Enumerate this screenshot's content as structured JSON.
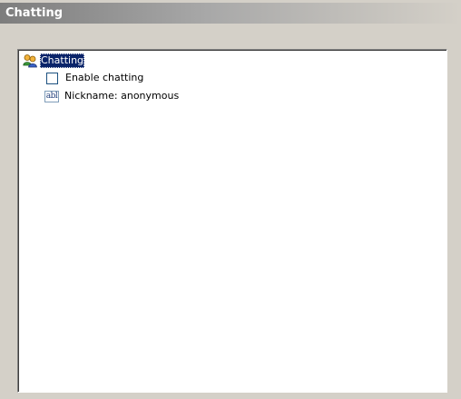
{
  "header": {
    "title": "Chatting"
  },
  "tree": {
    "root": {
      "label": "Chatting",
      "icon": "users-icon",
      "selected": true
    },
    "items": [
      {
        "type": "checkbox",
        "label": "Enable chatting",
        "checked": false
      },
      {
        "type": "text-field",
        "label": "Nickname: anonymous",
        "icon": "text-field-icon",
        "icon_text": "abl"
      }
    ]
  },
  "colors": {
    "background": "#d4d0c8",
    "selection": "#0a246a",
    "panel": "#ffffff",
    "header_gradient_start": "#7d7d7d"
  }
}
